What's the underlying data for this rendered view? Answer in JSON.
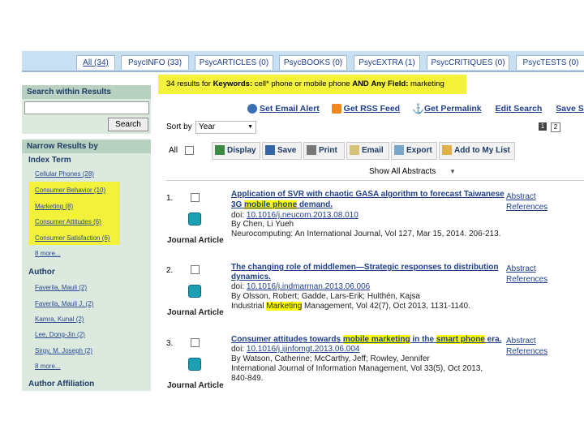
{
  "tabs": [
    {
      "label": "All (34)"
    },
    {
      "label": "PsycINFO (33)"
    },
    {
      "label": "PsycARTICLES (0)"
    },
    {
      "label": "PsycBOOKS (0)"
    },
    {
      "label": "PsycEXTRA (1)"
    },
    {
      "label": "PsycCRITIQUES (0)"
    },
    {
      "label": "PsycTESTS (0)"
    }
  ],
  "search_within": {
    "title": "Search within Results",
    "button": "Search"
  },
  "narrow": {
    "title": "Narrow Results by",
    "index_term": {
      "heading": "Index Term",
      "items": [
        "Cellular Phones (28)",
        "Consumer Behavior (10)",
        "Marketing (8)",
        "Consumer Attitudes (6)",
        "Consumer Satisfaction (6)"
      ],
      "more": "8 more..."
    },
    "author": {
      "heading": "Author",
      "items": [
        "Faverila, Mauli (2)",
        "Faverila, Mauli J. (2)",
        "Kamra, Kunal (2)",
        "Lee, Dong-Jin (2)",
        "Sirgy, M. Joseph (2)"
      ],
      "more": "8 more..."
    },
    "author_affiliation": {
      "heading": "Author Affiliation"
    }
  },
  "query_summary": {
    "count_text": "34 results for",
    "keywords_label": "Keywords",
    "keywords_value": "cell* phone or mobile phone",
    "and_text": "AND",
    "any_field_label": "Any Field",
    "any_field_value": "marketing"
  },
  "actions": {
    "alert": "Set Email Alert",
    "rss": "Get RSS Feed",
    "permalink": "Get Permalink",
    "edit": "Edit Search",
    "save": "Save Search"
  },
  "sort": {
    "label": "Sort by",
    "value": "Year"
  },
  "pages": [
    "1",
    "2"
  ],
  "toolbar": {
    "all": "All",
    "display": "Display",
    "save": "Save",
    "print": "Print",
    "email": "Email",
    "export": "Export",
    "add": "Add to My List"
  },
  "show_abstracts": "Show All Abstracts",
  "results": [
    {
      "num": "1.",
      "title_pre": "Application of SVR with chaotic GASA algorithm to forecast Taiwanese",
      "title_line2_pre": "3G",
      "title_line2_hl": "mobile phone",
      "title_line2_post": "demand.",
      "doi_label": "doi:",
      "doi": "10.1016/j.neucom.2013.08.010",
      "authors": "By Chen, Li Yueh",
      "source": "Neurocomputing: An International Journal, Vol 127, Mar 15, 2014. 206-213.",
      "type": "Journal Article",
      "abstract": "Abstract",
      "references": "References"
    },
    {
      "num": "2.",
      "title_pre": "The changing role of middlemen—Strategic responses to distribution",
      "title_line2_post": "dynamics.",
      "doi_label": "doi:",
      "doi": "10.1016/j.indmarman.2013.06.006",
      "authors": "By Olsson, Robert; Gadde, Lars-Erik; Hulthén, Kajsa",
      "source_pre": "Industrial",
      "source_hl": "Marketing",
      "source_post": "Management, Vol 42(7), Oct 2013, 1131-1140.",
      "type": "Journal Article",
      "abstract": "Abstract",
      "references": "References"
    },
    {
      "num": "3.",
      "title_pre": "Consumer attitudes towards",
      "title_hl1": "mobile marketing",
      "title_mid": "in the",
      "title_hl2": "smart phone",
      "title_post": "era.",
      "doi_label": "doi:",
      "doi": "10.1016/j.ijinfomgt.2013.06.004",
      "authors": "By Watson, Catherine; McCarthy, Jeff; Rowley, Jennifer",
      "source": "International Journal of Information Management, Vol 33(5), Oct 2013,",
      "source2": "840-849.",
      "type": "Journal Article",
      "abstract": "Abstract",
      "references": "References"
    }
  ]
}
